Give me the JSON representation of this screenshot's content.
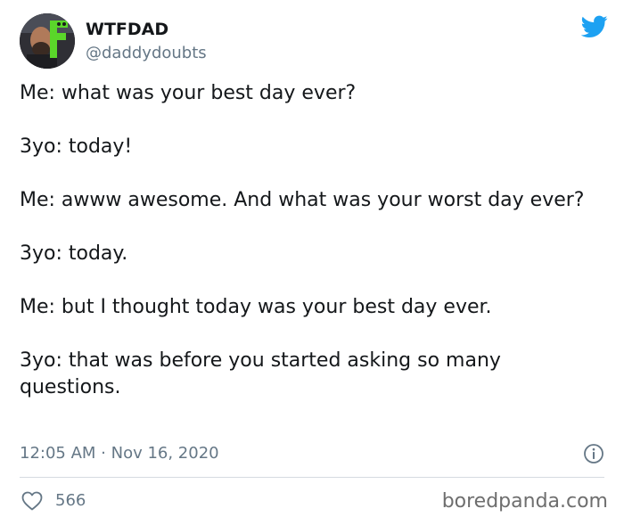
{
  "author": {
    "name": "WTFDAD",
    "handle": "@daddydoubts",
    "avatar_icon": "profile-photo",
    "brand_icon": "twitter-bird-icon",
    "brand_color": "#1da1f2"
  },
  "tweet": {
    "paragraphs": [
      "Me: what was your best day ever?",
      "3yo: today!",
      "Me: awww awesome. And what was your worst day ever?",
      "3yo: today.",
      "Me: but I thought today was your best day ever.",
      "3yo: that was before you started asking so many questions."
    ],
    "timestamp": "12:05 AM · Nov 16, 2020"
  },
  "actions": {
    "like_icon": "heart-icon",
    "like_count": "566",
    "info_icon": "info-icon"
  },
  "watermark": "boredpanda.com"
}
